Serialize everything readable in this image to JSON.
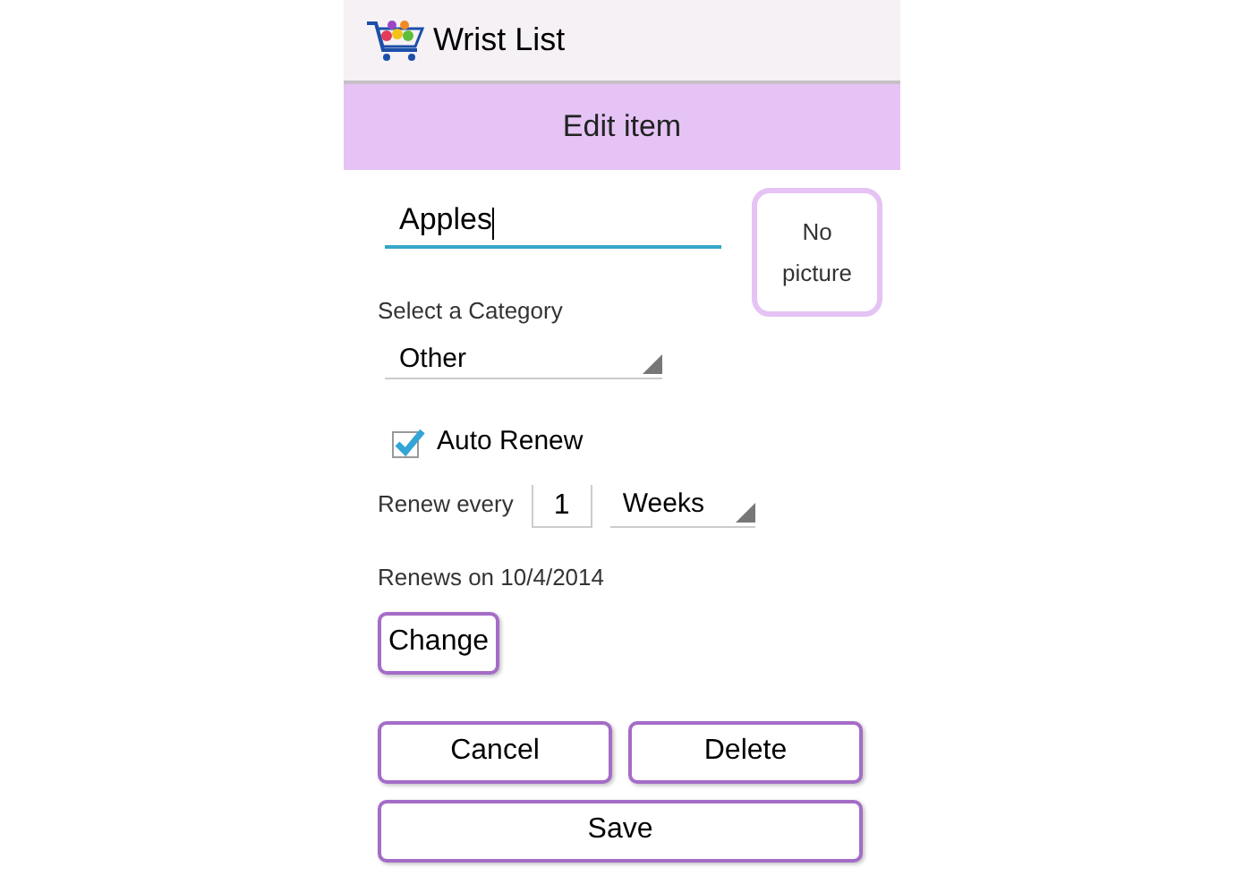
{
  "app_bar": {
    "title": "Wrist List"
  },
  "header": {
    "title": "Edit item"
  },
  "name_field": {
    "value": "Apples"
  },
  "picture_button": {
    "label": "No picture"
  },
  "category": {
    "label": "Select a Category",
    "value": "Other"
  },
  "auto_renew": {
    "label": "Auto Renew",
    "checked": true
  },
  "renew": {
    "label": "Renew every",
    "count": "1",
    "unit": "Weeks"
  },
  "renews_on": "Renews on 10/4/2014",
  "change_button": "Change",
  "buttons": [
    {
      "label": "Cancel"
    },
    {
      "label": "Delete"
    },
    {
      "label": "Save"
    }
  ]
}
